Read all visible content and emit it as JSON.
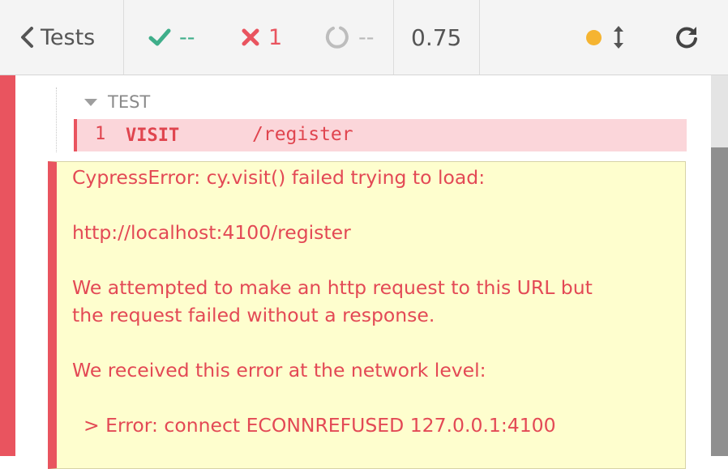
{
  "header": {
    "back_label": "Tests",
    "passed": "--",
    "failed": "1",
    "pending": "--",
    "duration": "0.75",
    "icons": {
      "back": "chevron-left-icon",
      "passed": "check-icon",
      "failed": "x-icon",
      "pending": "circle-notch-icon",
      "status_dot": "status-dot-icon",
      "resize": "resize-vertical-icon",
      "reload": "reload-icon"
    },
    "colors": {
      "passed": "#3fae8a",
      "failed": "#e9545f",
      "pending": "#b9b9b9",
      "running": "#f5b431"
    }
  },
  "test": {
    "section_label": "TEST",
    "command": {
      "number": "1",
      "name": "VISIT",
      "message": "/register"
    }
  },
  "error": {
    "lines": [
      "CypressError: cy.visit() failed trying to load:",
      "http://localhost:4100/register",
      "We attempted to make an http request to this URL but",
      "the request failed without a response.",
      "We received this error at the network level:",
      "> Error: connect ECONNREFUSED 127.0.0.1:4100"
    ]
  }
}
